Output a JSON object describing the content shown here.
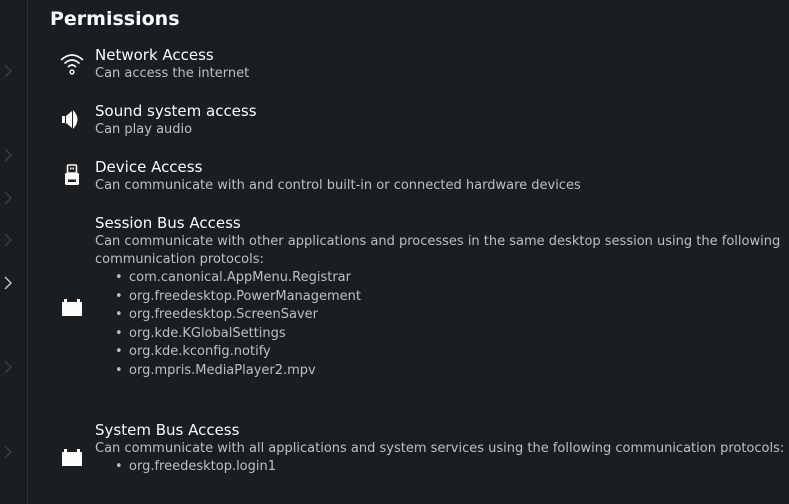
{
  "section": {
    "title": "Permissions"
  },
  "permissions": [
    {
      "name": "Network Access",
      "description": "Can access the internet",
      "icon": "wifi-icon"
    },
    {
      "name": "Sound system access",
      "description": "Can play audio",
      "icon": "speaker-icon"
    },
    {
      "name": "Device Access",
      "description": "Can communicate with and control built-in or connected hardware devices",
      "icon": "usb-drive-icon"
    },
    {
      "name": "Session Bus Access",
      "description": "Can communicate with other applications and processes in the same desktop session using the following communication protocols:",
      "icon": "bus-icon",
      "protocols": [
        "com.canonical.AppMenu.Registrar",
        "org.freedesktop.PowerManagement",
        "org.freedesktop.ScreenSaver",
        "org.kde.KGlobalSettings",
        "org.kde.kconfig.notify",
        "org.mpris.MediaPlayer2.mpv"
      ]
    },
    {
      "name": "System Bus Access",
      "description": "Can communicate with all applications and system services using the following communication protocols:",
      "icon": "bus-icon",
      "protocols": [
        "org.freedesktop.login1"
      ]
    }
  ],
  "colors": {
    "background": "#1b1e20",
    "text_primary": "#fcfcfc",
    "text_secondary": "#bdc0c3"
  }
}
